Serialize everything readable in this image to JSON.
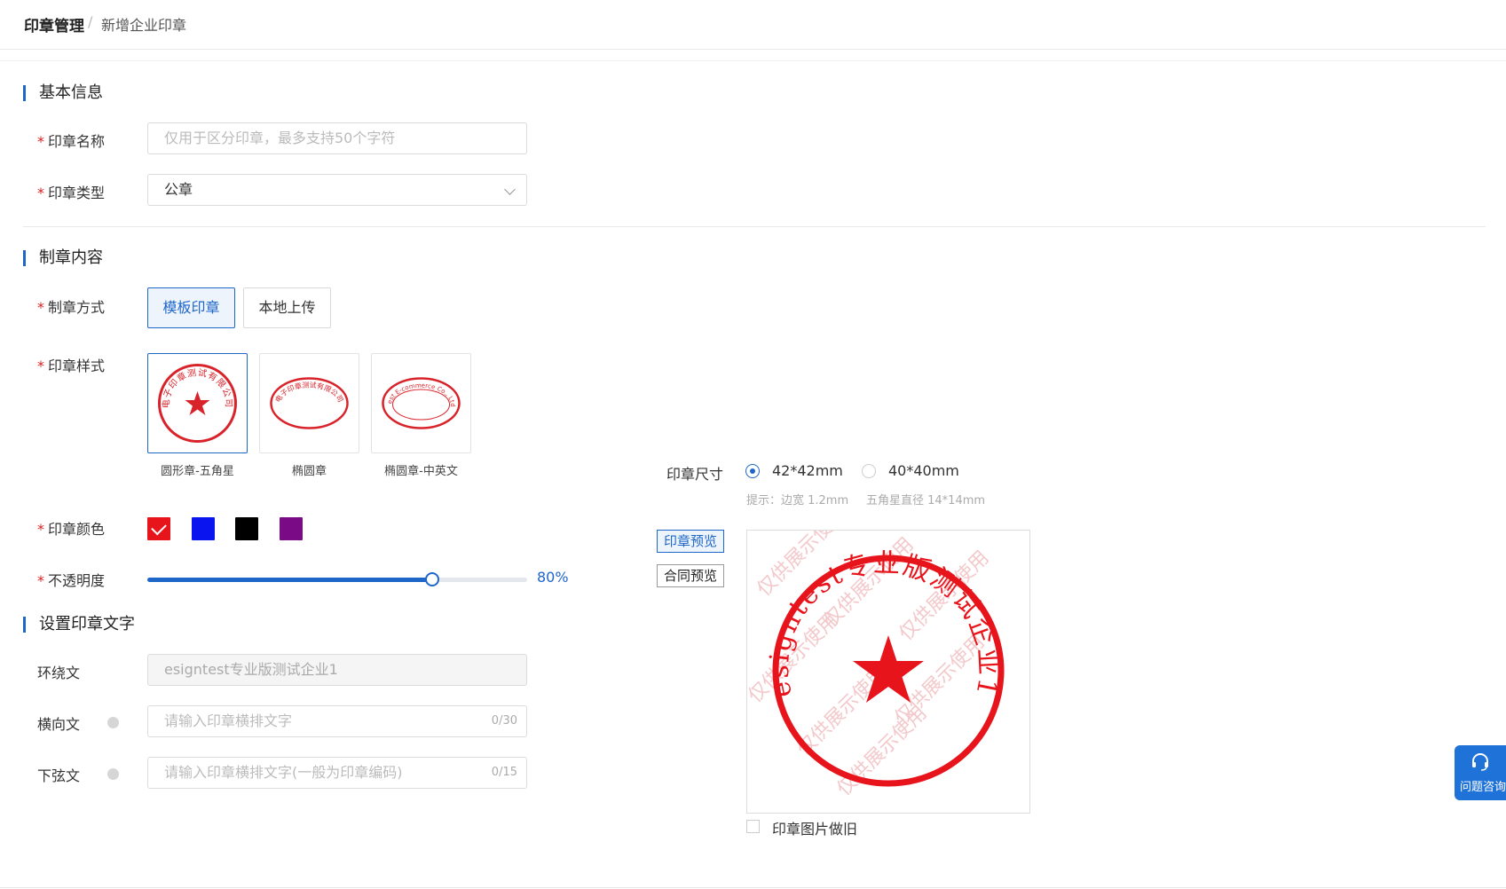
{
  "breadcrumb": {
    "root": "印章管理",
    "separator": "/",
    "current": "新增企业印章"
  },
  "sections": {
    "basic": "基本信息",
    "content": "制章内容",
    "text": "设置印章文字"
  },
  "form": {
    "name": {
      "label": "印章名称",
      "placeholder": "仅用于区分印章，最多支持50个字符"
    },
    "type": {
      "label": "印章类型",
      "value": "公章"
    },
    "method": {
      "label": "制章方式",
      "options": [
        "模板印章",
        "本地上传"
      ],
      "selected": "模板印章"
    },
    "style": {
      "label": "印章样式",
      "options": [
        {
          "caption": "圆形章-五角星",
          "selected": true,
          "sample_text": "电子印章测试有限公司"
        },
        {
          "caption": "椭圆章",
          "selected": false,
          "sample_text": "电子印章测试有限公司"
        },
        {
          "caption": "椭圆章-中英文",
          "selected": false,
          "sample_text": "Test E-commerce Co., Ltd"
        }
      ]
    },
    "color": {
      "label": "印章颜色",
      "options": [
        "#e8141c",
        "#0a14ee",
        "#000000",
        "#7a0a86"
      ],
      "selected_index": 0
    },
    "opacity": {
      "label": "不透明度",
      "value": 0.8,
      "display": "80%"
    },
    "ring_text": {
      "label": "环绕文",
      "value": "esigntest专业版测试企业1"
    },
    "horizontal_text": {
      "label": "横向文",
      "placeholder": "请输入印章横排文字",
      "counter": "0/30"
    },
    "bottom_text": {
      "label": "下弦文",
      "placeholder": "请输入印章横排文字(一般为印章编码)",
      "counter": "0/15"
    }
  },
  "size": {
    "label": "印章尺寸",
    "options": [
      "42*42mm",
      "40*40mm"
    ],
    "selected_index": 0,
    "hint_prefix": "提示：边宽 1.2mm",
    "hint_star": "五角星直径 14*14mm"
  },
  "preview": {
    "seal_preview_button": "印章预览",
    "contract_preview_button": "合同预览",
    "seal_ring_text": "esigntest专业版测试企业1",
    "watermark": "仅供展示使用",
    "aged_checkbox_label": "印章图片做旧",
    "seal_color": "#e8141c"
  },
  "help": {
    "label": "问题咨询",
    "icon": "headset-icon"
  }
}
